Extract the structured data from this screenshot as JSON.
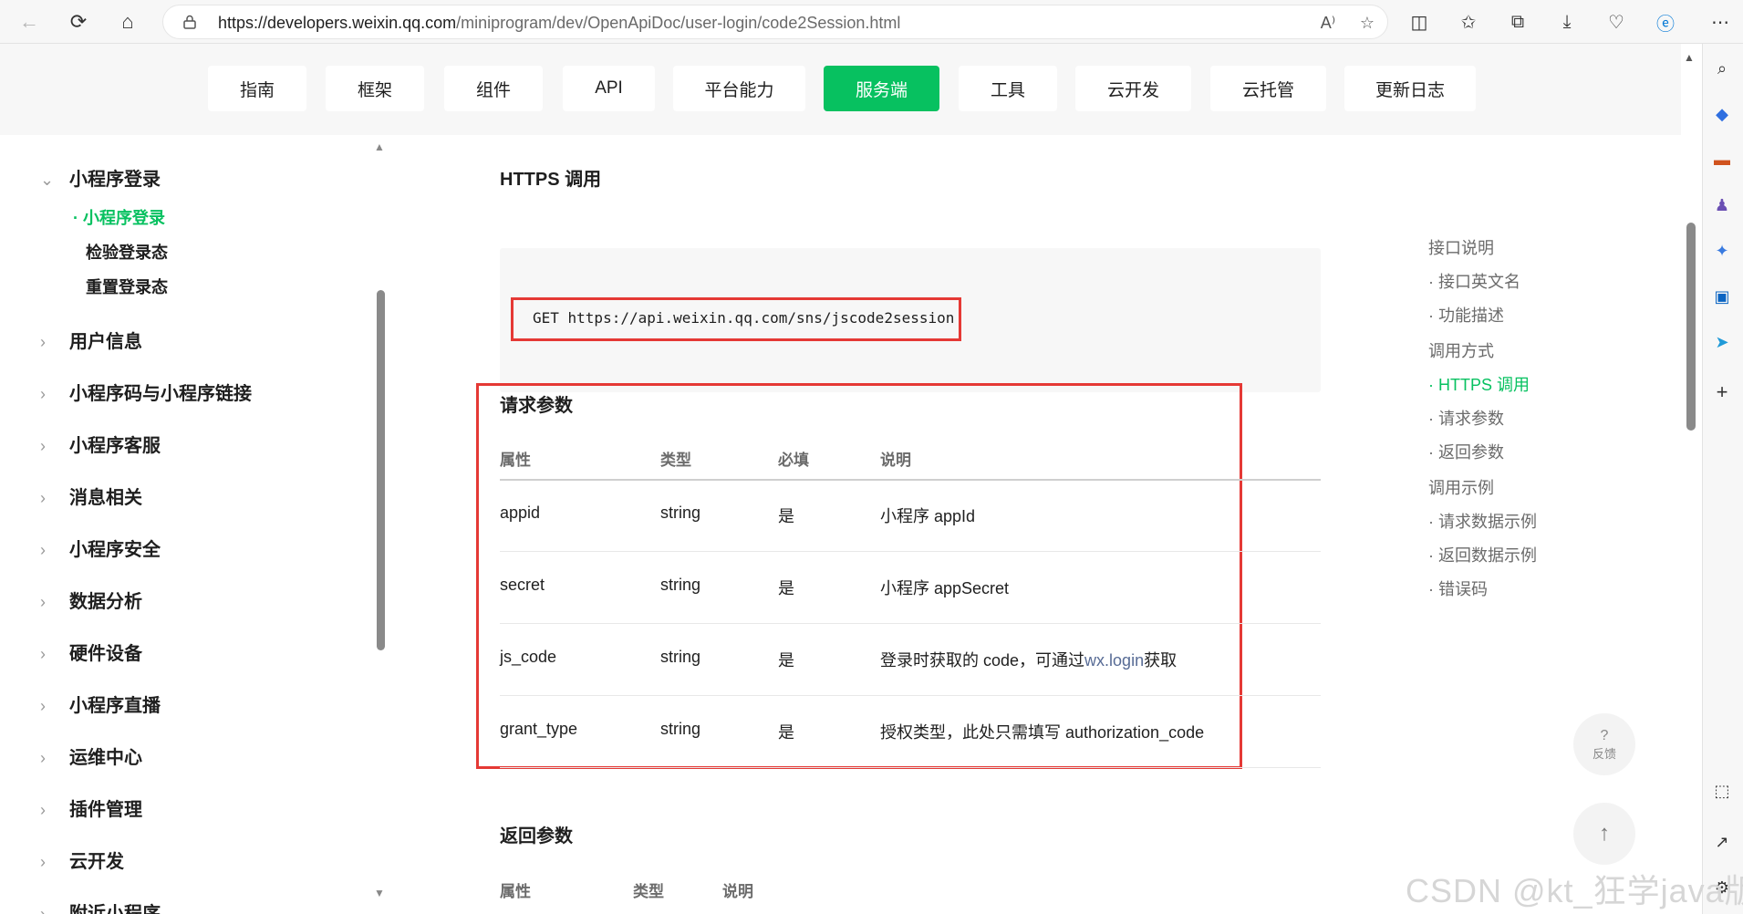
{
  "browser": {
    "url_host": "https://developers.weixin.qq.com",
    "url_path": "/miniprogram/dev/OpenApiDoc/user-login/code2Session.html",
    "read_aloud_icon": "A⁾"
  },
  "topnav": {
    "tabs": [
      {
        "label": "指南"
      },
      {
        "label": "框架"
      },
      {
        "label": "组件"
      },
      {
        "label": "API"
      },
      {
        "label": "平台能力"
      },
      {
        "label": "服务端",
        "active": true
      },
      {
        "label": "工具"
      },
      {
        "label": "云开发"
      },
      {
        "label": "云托管"
      },
      {
        "label": "更新日志"
      }
    ],
    "accent_color": "#07c160"
  },
  "sidebar": {
    "group": "小程序登录",
    "sub_items": [
      "小程序登录",
      "检验登录态",
      "重置登录态"
    ],
    "items": [
      "用户信息",
      "小程序码与小程序链接",
      "小程序客服",
      "消息相关",
      "小程序安全",
      "数据分析",
      "硬件设备",
      "小程序直播",
      "运维中心",
      "插件管理",
      "云开发",
      "附近小程序"
    ]
  },
  "content": {
    "https_title": "HTTPS 调用",
    "code": "GET https://api.weixin.qq.com/sns/jscode2session",
    "request_title": "请求参数",
    "request_headers": [
      "属性",
      "类型",
      "必填",
      "说明"
    ],
    "request_rows": [
      {
        "name": "appid",
        "type": "string",
        "required": "是",
        "desc": "小程序 appId"
      },
      {
        "name": "secret",
        "type": "string",
        "required": "是",
        "desc": "小程序 appSecret"
      },
      {
        "name": "js_code",
        "type": "string",
        "required": "是",
        "desc_pre": "登录时获取的 code，可通过",
        "desc_link": "wx.login",
        "desc_post": "获取"
      },
      {
        "name": "grant_type",
        "type": "string",
        "required": "是",
        "desc": "授权类型，此处只需填写 authorization_code"
      }
    ],
    "response_title": "返回参数",
    "response_headers": [
      "属性",
      "类型",
      "说明"
    ]
  },
  "toc": {
    "items": [
      "接口说明",
      "· 接口英文名",
      "· 功能描述",
      "调用方式",
      "· HTTPS 调用",
      "· 请求参数",
      "· 返回参数",
      "调用示例",
      "· 请求数据示例",
      "· 返回数据示例",
      "· 错误码"
    ]
  },
  "float": {
    "feedback_label": "反馈",
    "feedback_mark": "?",
    "back_to_top": "↑"
  },
  "watermark": "CSDN @kt_狂学java版"
}
